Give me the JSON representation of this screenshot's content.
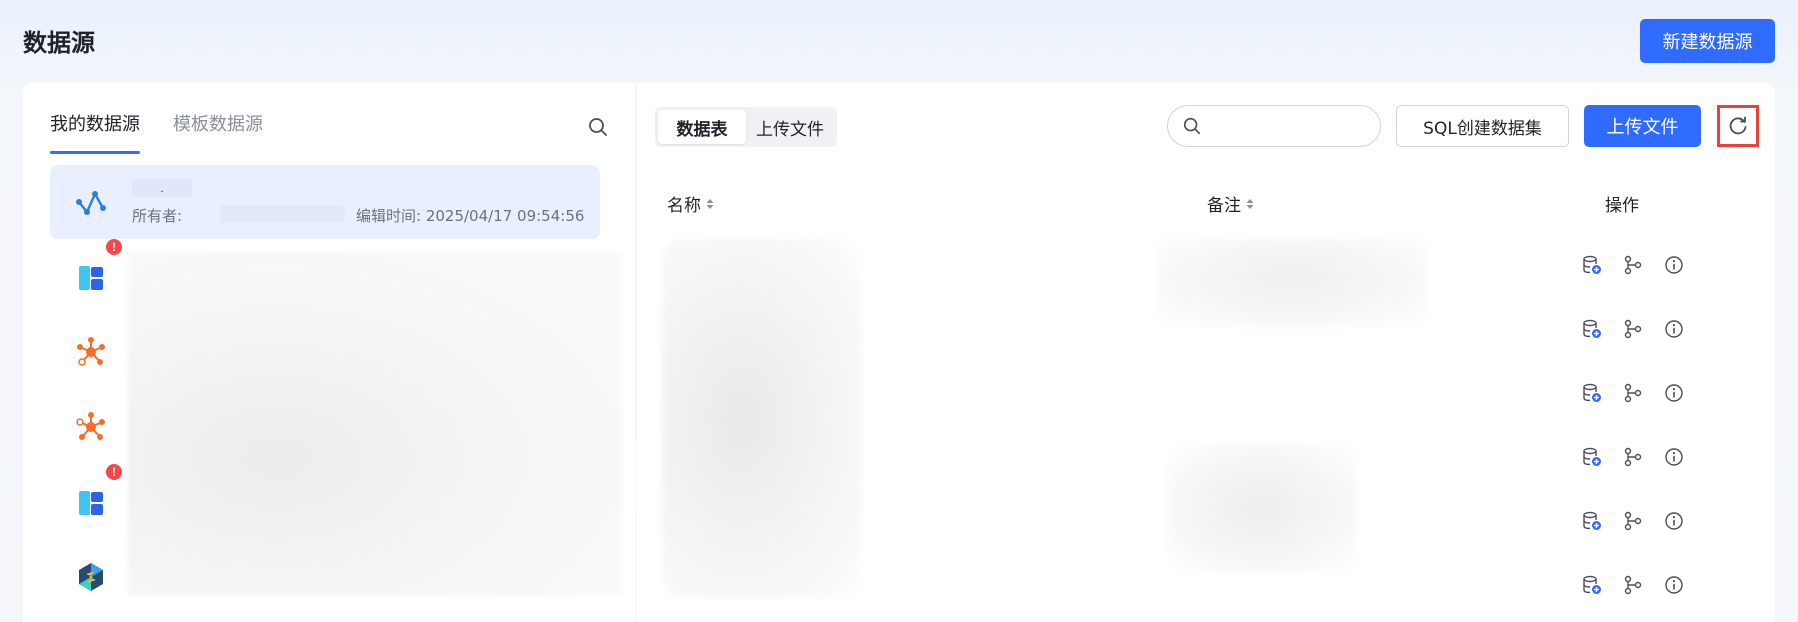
{
  "header": {
    "title": "数据源",
    "new_datasource_label": "新建数据源"
  },
  "left_panel": {
    "tabs": [
      {
        "label": "我的数据源",
        "active": true
      },
      {
        "label": "模板数据源",
        "active": false
      }
    ],
    "selected_item": {
      "name": ".",
      "owner_label": "所有者:",
      "edit_time_label": "编辑时间: 2025/04/17 09:54:56"
    },
    "items": [
      {
        "icon": "chart-line-icon",
        "selected": true
      },
      {
        "icon": "blue-blocks-icon",
        "badge": "!"
      },
      {
        "icon": "orange-network-icon"
      },
      {
        "icon": "orange-network-icon"
      },
      {
        "icon": "blue-blocks-icon",
        "badge": "!"
      },
      {
        "icon": "hexagon-s-icon"
      }
    ]
  },
  "right_panel": {
    "segments": [
      {
        "label": "数据表",
        "active": true
      },
      {
        "label": "上传文件",
        "active": false
      }
    ],
    "search": {
      "placeholder": ""
    },
    "sql_create_label": "SQL创建数据集",
    "upload_label": "上传文件",
    "columns": [
      "名称",
      "备注",
      "操作"
    ],
    "row_count": 6
  },
  "colors": {
    "primary": "#2f6bff",
    "highlight_border": "#e8423c",
    "selected_bg": "#e9efff",
    "badge": "#f5484b"
  }
}
